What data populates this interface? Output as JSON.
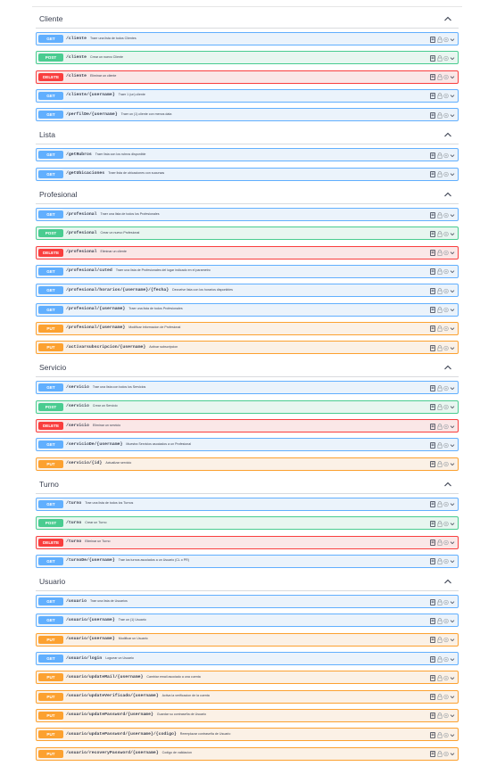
{
  "groups": [
    {
      "title": "Cliente",
      "operations": [
        {
          "method": "GET",
          "path": "/cliente",
          "description": "Traer una lista de todos Clientes"
        },
        {
          "method": "POST",
          "path": "/cliente",
          "description": "Crear un nuevo Cliente"
        },
        {
          "method": "DELETE",
          "path": "/cliente",
          "description": "Eliminar un cliente"
        },
        {
          "method": "GET",
          "path": "/cliente/{username}",
          "description": "Traer 1 (un) cliente"
        },
        {
          "method": "GET",
          "path": "/perfilDe/{username}",
          "description": "Traer un (1) cliente con menos data"
        }
      ]
    },
    {
      "title": "Lista",
      "operations": [
        {
          "method": "GET",
          "path": "/getRubros",
          "description": "Traer lista con los rubros disponible"
        },
        {
          "method": "GET",
          "path": "/getUbicaciones",
          "description": "Traer lista de ubicaciones con sucursas"
        }
      ]
    },
    {
      "title": "Profesional",
      "operations": [
        {
          "method": "GET",
          "path": "/profesional",
          "description": "Traer una lista de todos los Profesionales"
        },
        {
          "method": "POST",
          "path": "/profesional",
          "description": "Crear un nuevo Profesional"
        },
        {
          "method": "DELETE",
          "path": "/profesional",
          "description": "Eliminar un cliente"
        },
        {
          "method": "GET",
          "path": "/profesional/cuted",
          "description": "Traer una lista de Profesionales del lugar indicado en el parametro"
        },
        {
          "method": "GET",
          "path": "/profesional/horarios/{username}/{fecha}",
          "description": "Devuelve lista con los horarios disponibles"
        },
        {
          "method": "GET",
          "path": "/profesional/{username}",
          "description": "Traer una lista de todos Profesionales"
        },
        {
          "method": "PUT",
          "path": "/profesional/{username}",
          "description": "Modificar informacion de Profesional"
        },
        {
          "method": "PUT",
          "path": "/activarsubscripcion/{username}",
          "description": "Activar subscripcion"
        }
      ]
    },
    {
      "title": "Servicio",
      "operations": [
        {
          "method": "GET",
          "path": "/servicio",
          "description": "Trae una lista con todos los Servicios"
        },
        {
          "method": "POST",
          "path": "/servicio",
          "description": "Crear un Servicio"
        },
        {
          "method": "DELETE",
          "path": "/servicio",
          "description": "Eliminar un servicio"
        },
        {
          "method": "GET",
          "path": "/servicioDe/{username}",
          "description": "Muestra Servicios asociados a un Profesional"
        },
        {
          "method": "PUT",
          "path": "/servicio/{id}",
          "description": "Actualizar servicio"
        }
      ]
    },
    {
      "title": "Turno",
      "operations": [
        {
          "method": "GET",
          "path": "/turno",
          "description": "Trae una lista de todos los Turnos"
        },
        {
          "method": "POST",
          "path": "/turno",
          "description": "Crear un Turno"
        },
        {
          "method": "DELETE",
          "path": "/turno",
          "description": "Eliminar un Turno"
        },
        {
          "method": "GET",
          "path": "/turnoDe/{username}",
          "description": "Trae los turnos asociados a un Usuario (CL o PR)"
        }
      ]
    },
    {
      "title": "Usuario",
      "operations": [
        {
          "method": "GET",
          "path": "/usuario",
          "description": "Trae una lista de Usuarios"
        },
        {
          "method": "GET",
          "path": "/usuario/{username}",
          "description": "Trae un (1) Usuario"
        },
        {
          "method": "PUT",
          "path": "/usuario/{username}",
          "description": "Modificar un Usuario"
        },
        {
          "method": "GET",
          "path": "/usuario/login",
          "description": "Loguear un Usuario"
        },
        {
          "method": "PUT",
          "path": "/usuario/updateMail/{username}",
          "description": "Cambiar email asociado a una cuenta"
        },
        {
          "method": "PUT",
          "path": "/usuario/updateVerificado/{username}",
          "description": "Activa la verificacion de la cuenta"
        },
        {
          "method": "PUT",
          "path": "/usuario/updatePassword/{username}",
          "description": "Guardar su contraseña de Usuario"
        },
        {
          "method": "PUT",
          "path": "/usuario/updatePassword/{username}/{codigo}",
          "description": "Reemplazar contraseña de Usuario"
        },
        {
          "method": "PUT",
          "path": "/usuario/recoveryPassword/{username}",
          "description": "Codigo de validacion"
        }
      ]
    }
  ]
}
